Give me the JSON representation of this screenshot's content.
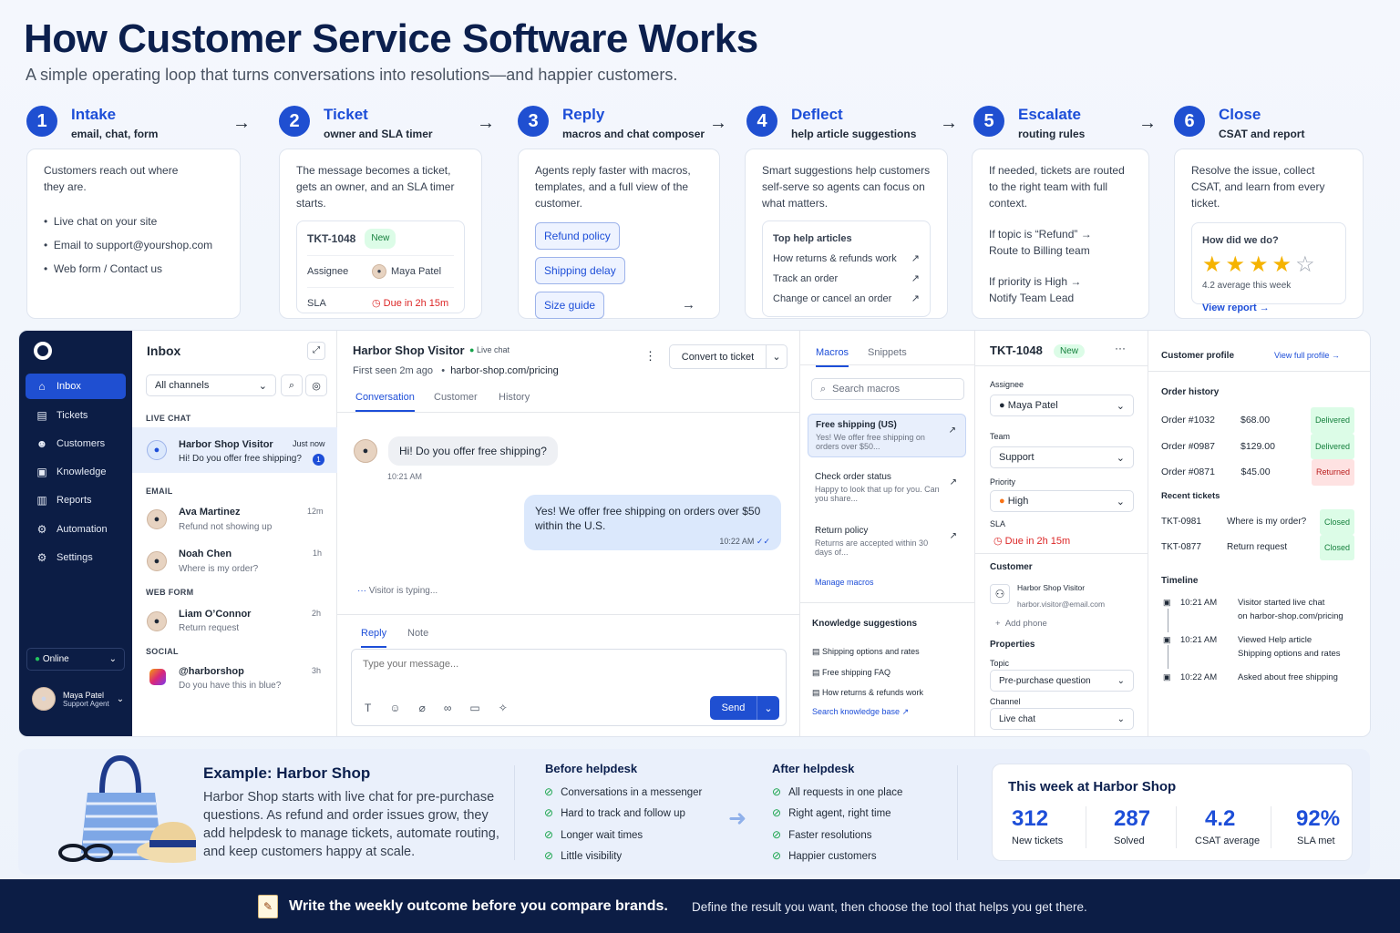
{
  "header": {
    "title": "How Customer Service Software Works",
    "subtitle": "A simple operating loop that turns conversations into resolutions—and happier customers."
  },
  "steps": [
    {
      "num": "1",
      "title": "Intake",
      "sub": "email, chat, form",
      "desc": "Customers reach out where they are.",
      "bullets": [
        "Live chat on your site",
        "Email to support@yourshop.com",
        "Web form / Contact us"
      ]
    },
    {
      "num": "2",
      "title": "Ticket",
      "sub": "owner and SLA timer",
      "desc": "The message becomes a ticket, gets an owner, and an SLA timer starts.",
      "ticket_id": "TKT-1048",
      "badge": "New",
      "assignee_label": "Assignee",
      "assignee": "Maya Patel",
      "sla_label": "SLA",
      "sla": "Due in 2h 15m"
    },
    {
      "num": "3",
      "title": "Reply",
      "sub": "macros and chat composer",
      "desc": "Agents reply faster with macros, templates, and a full view of the customer.",
      "macros": [
        "Refund policy",
        "Shipping delay",
        "Size guide"
      ]
    },
    {
      "num": "4",
      "title": "Deflect",
      "sub": "help article suggestions",
      "desc": "Smart suggestions help customers self-serve so agents can focus on what matters.",
      "box_title": "Top help articles",
      "articles": [
        "How returns & refunds work",
        "Track an order",
        "Change or cancel an order"
      ]
    },
    {
      "num": "5",
      "title": "Escalate",
      "sub": "routing rules",
      "desc": "If needed, tickets are routed to the right team with full context.",
      "rule1a": "If topic is “Refund” →",
      "rule1b": "Route to Billing team",
      "rule2a": "If priority is High →",
      "rule2b": "Notify Team Lead"
    },
    {
      "num": "6",
      "title": "Close",
      "sub": "CSAT and report",
      "desc": "Resolve the issue, collect CSAT, and learn from every ticket.",
      "question": "How did we do?",
      "rating": 4,
      "avg": "4.2 average this week",
      "report": "View report"
    }
  ],
  "sidebar": {
    "items": [
      {
        "label": "Inbox",
        "icon": "inbox-icon",
        "glyph": "⌂"
      },
      {
        "label": "Tickets",
        "icon": "ticket-icon",
        "glyph": "▤"
      },
      {
        "label": "Customers",
        "icon": "users-icon",
        "glyph": "☻"
      },
      {
        "label": "Knowledge",
        "icon": "book-icon",
        "glyph": "▣"
      },
      {
        "label": "Reports",
        "icon": "chart-icon",
        "glyph": "▥"
      },
      {
        "label": "Automation",
        "icon": "automation-icon",
        "glyph": "⚙"
      },
      {
        "label": "Settings",
        "icon": "settings-icon",
        "glyph": "⚙"
      }
    ],
    "status": "Online",
    "user_name": "Maya Patel",
    "user_role": "Support Agent"
  },
  "inbox": {
    "title": "Inbox",
    "filter": "All channels",
    "sections": {
      "live": "LIVE CHAT",
      "email": "EMAIL",
      "web": "WEB FORM",
      "social": "SOCIAL"
    },
    "items": [
      {
        "name": "Harbor Shop Visitor",
        "time": "Just now",
        "preview": "Hi! Do you offer free shipping?",
        "unread": "1"
      },
      {
        "name": "Ava Martinez",
        "time": "12m",
        "preview": "Refund not showing up"
      },
      {
        "name": "Noah Chen",
        "time": "1h",
        "preview": "Where is my order?"
      },
      {
        "name": "Liam O’Connor",
        "time": "2h",
        "preview": "Return request"
      },
      {
        "name": "@harborshop",
        "time": "3h",
        "preview": "Do you have this in blue?"
      }
    ]
  },
  "conversation": {
    "name": "Harbor Shop Visitor",
    "status": "Live chat",
    "first_seen": "First seen 2m ago",
    "page": "harbor-shop.com/pricing",
    "convert": "Convert to ticket",
    "tabs": [
      "Conversation",
      "Customer",
      "History"
    ],
    "msg_in": "Hi! Do you offer free shipping?",
    "msg_in_time": "10:21 AM",
    "msg_out": "Yes! We offer free shipping on orders over $50 within the U.S.",
    "msg_out_time": "10:22 AM",
    "typing": "Visitor is typing...",
    "reply_tabs": [
      "Reply",
      "Note"
    ],
    "placeholder": "Type your message...",
    "send": "Send"
  },
  "macros": {
    "tabs": [
      "Macros",
      "Snippets"
    ],
    "search": "Search macros",
    "items": [
      {
        "title": "Free shipping (US)",
        "body": "Yes! We offer free shipping on orders over $50..."
      },
      {
        "title": "Check order status",
        "body": "Happy to look that up for you. Can you share..."
      },
      {
        "title": "Return policy",
        "body": "Returns are accepted within 30 days of..."
      }
    ],
    "manage": "Manage macros",
    "kb_title": "Knowledge suggestions",
    "kb": [
      "Shipping options and rates",
      "Free shipping FAQ",
      "How returns & refunds work"
    ],
    "kb_link": "Search knowledge base"
  },
  "ticket": {
    "id": "TKT-1048",
    "badge": "New",
    "assignee_label": "Assignee",
    "assignee": "Maya Patel",
    "team_label": "Team",
    "team": "Support",
    "priority_label": "Priority",
    "priority": "High",
    "sla_label": "SLA",
    "sla": "Due in 2h 15m",
    "customer_label": "Customer",
    "customer_name": "Harbor Shop Visitor",
    "customer_email": "harbor.visitor@email.com",
    "add_phone": "Add phone",
    "props_label": "Properties",
    "topic_label": "Topic",
    "topic": "Pre-purchase question",
    "channel_label": "Channel",
    "channel": "Live chat"
  },
  "profile": {
    "title": "Customer profile",
    "link": "View full profile",
    "orders_title": "Order history",
    "orders": [
      {
        "id": "Order #1032",
        "amount": "$68.00",
        "status": "Delivered",
        "ok": true
      },
      {
        "id": "Order #0987",
        "amount": "$129.00",
        "status": "Delivered",
        "ok": true
      },
      {
        "id": "Order #0871",
        "amount": "$45.00",
        "status": "Returned",
        "ok": false
      }
    ],
    "tickets_title": "Recent tickets",
    "tickets": [
      {
        "id": "TKT-0981",
        "subject": "Where is my order?",
        "status": "Closed"
      },
      {
        "id": "TKT-0877",
        "subject": "Return request",
        "status": "Closed"
      }
    ],
    "timeline_title": "Timeline",
    "timeline": [
      {
        "time": "10:21 AM",
        "l1": "Visitor started live chat",
        "l2": "on harbor-shop.com/pricing"
      },
      {
        "time": "10:21 AM",
        "l1": "Viewed Help article",
        "l2": "Shipping options and rates"
      },
      {
        "time": "10:22 AM",
        "l1": "Asked about free shipping",
        "l2": ""
      }
    ]
  },
  "example": {
    "title": "Example: Harbor Shop",
    "text": "Harbor Shop starts with live chat for pre-purchase questions. As refund and order issues grow, they add helpdesk to manage tickets, automate routing, and keep customers happy at scale.",
    "before_title": "Before helpdesk",
    "before": [
      "Conversations in a messenger",
      "Hard to track and follow up",
      "Longer wait times",
      "Little visibility"
    ],
    "after_title": "After helpdesk",
    "after": [
      "All requests in one place",
      "Right agent, right time",
      "Faster resolutions",
      "Happier customers"
    ],
    "stats_title": "This week at Harbor Shop",
    "stats": [
      {
        "value": "312",
        "label": "New tickets"
      },
      {
        "value": "287",
        "label": "Solved"
      },
      {
        "value": "4.2",
        "label": "CSAT average"
      },
      {
        "value": "92%",
        "label": "SLA met"
      }
    ]
  },
  "footer": {
    "bold": "Write the weekly outcome before you compare brands.",
    "text": "Define the result you want, then choose the tool that helps you get there."
  },
  "colors": {
    "accent": "#1d4ed8",
    "navy": "#0c1d45",
    "green": "#16a34a",
    "red": "#dc2626",
    "star": "#f5b301"
  }
}
